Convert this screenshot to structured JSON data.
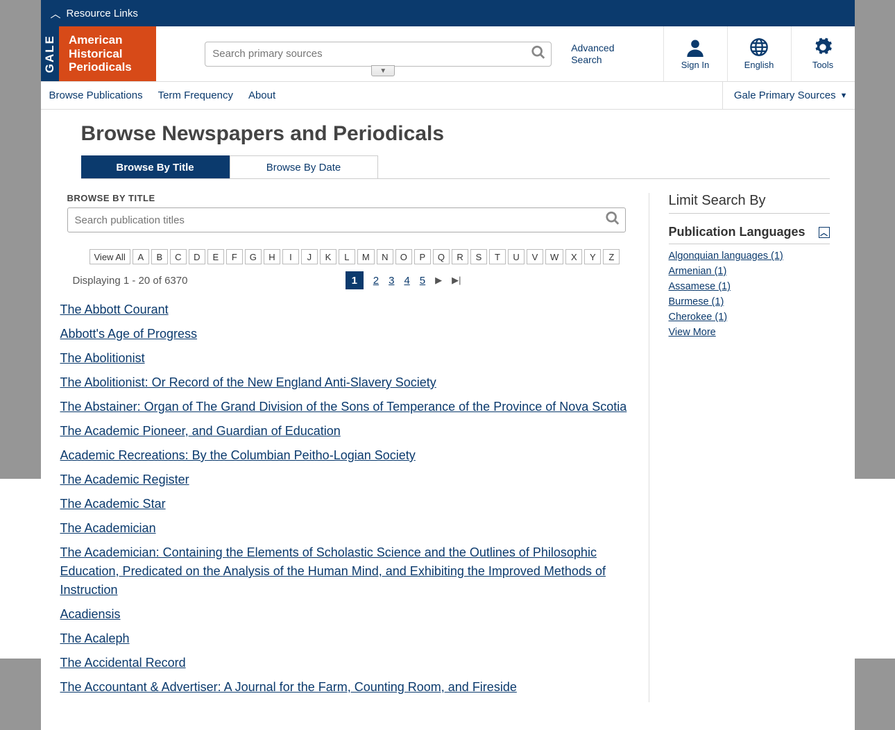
{
  "resource_bar": {
    "label": "Resource Links"
  },
  "header": {
    "gale": "GALE",
    "product": "American Historical Periodicals",
    "search_placeholder": "Search primary sources",
    "advanced": "Advanced Search",
    "tools": {
      "signin": "Sign In",
      "lang": "English",
      "tools": "Tools"
    }
  },
  "nav": {
    "browse_pubs": "Browse Publications",
    "term_freq": "Term Frequency",
    "about": "About",
    "gps": "Gale Primary Sources"
  },
  "page_title": "Browse Newspapers and Periodicals",
  "tabs": {
    "by_title": "Browse By Title",
    "by_date": "Browse By Date"
  },
  "browse_label": "BROWSE BY TITLE",
  "title_search_placeholder": "Search publication titles",
  "alpha": [
    "View All",
    "A",
    "B",
    "C",
    "D",
    "E",
    "F",
    "G",
    "H",
    "I",
    "J",
    "K",
    "L",
    "M",
    "N",
    "O",
    "P",
    "Q",
    "R",
    "S",
    "T",
    "U",
    "V",
    "W",
    "X",
    "Y",
    "Z"
  ],
  "display_text": "Displaying 1 - 20 of 6370",
  "pages": [
    "1",
    "2",
    "3",
    "4",
    "5"
  ],
  "results": [
    "The Abbott Courant",
    "Abbott's Age of Progress",
    "The Abolitionist",
    "The Abolitionist: Or Record of the New England Anti-Slavery Society",
    "The Abstainer: Organ of The Grand Division of the Sons of Temperance of the Province of Nova Scotia",
    "The Academic Pioneer, and Guardian of Education",
    "Academic Recreations: By the Columbian Peitho-Logian Society",
    "The Academic Register",
    "The Academic Star",
    "The Academician",
    "The Academician: Containing the Elements of Scholastic Science and the Outlines of Philosophic Education, Predicated on the Analysis of the Human Mind, and Exhibiting the Improved Methods of Instruction",
    "Acadiensis",
    "The Acaleph",
    "The Accidental Record",
    "The Accountant & Advertiser: A Journal for the Farm, Counting Room, and Fireside"
  ],
  "limit_title": "Limit Search By",
  "facet": {
    "title": "Publication Languages",
    "items": [
      "Algonquian languages (1)",
      "Armenian (1)",
      "Assamese (1)",
      "Burmese (1)",
      "Cherokee (1)"
    ],
    "view_more": "View More"
  }
}
